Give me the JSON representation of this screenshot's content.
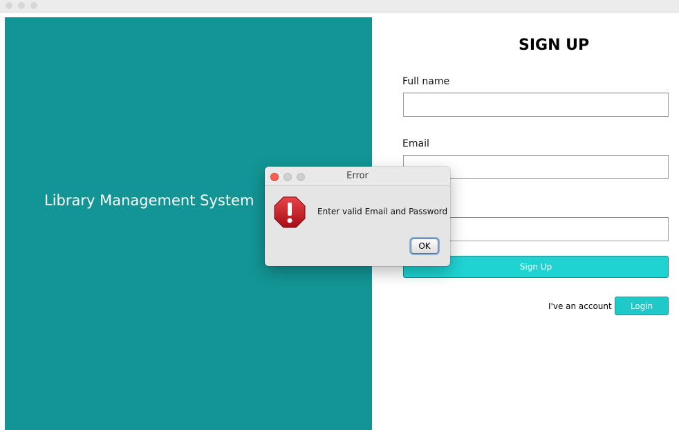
{
  "left_panel": {
    "title": "Library Management System",
    "background_color": "#139595"
  },
  "form": {
    "heading": "SIGN UP",
    "full_name_label": "Full name",
    "full_name_value": "",
    "email_label": "Email",
    "email_value": "",
    "password_value": "",
    "signup_label": "Sign Up",
    "account_text": "I've an account",
    "login_label": "Login",
    "accent_color": "#1fd3d3"
  },
  "dialog": {
    "title": "Error",
    "message": "Enter valid Email and Password",
    "ok_label": "OK",
    "icon": "error-stop-icon"
  }
}
